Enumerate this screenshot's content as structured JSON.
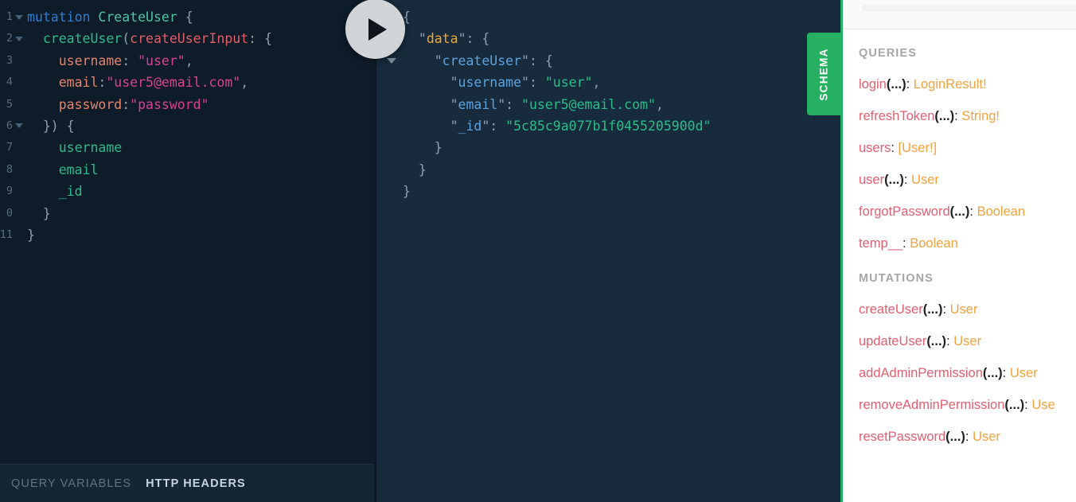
{
  "query_editor": {
    "lines": [
      {
        "num": "1",
        "fold": true,
        "tokens": [
          {
            "c": "t-kw",
            "t": "mutation"
          },
          {
            "c": "t-punct",
            "t": " "
          },
          {
            "c": "t-opname",
            "t": "CreateUser"
          },
          {
            "c": "t-punct",
            "t": " {"
          }
        ]
      },
      {
        "num": "2",
        "fold": true,
        "tokens": [
          {
            "c": "t-punct",
            "t": "  "
          },
          {
            "c": "t-field",
            "t": "createUser"
          },
          {
            "c": "t-punct",
            "t": "("
          },
          {
            "c": "t-argdef",
            "t": "createUserInput"
          },
          {
            "c": "t-punct",
            "t": ": {"
          }
        ]
      },
      {
        "num": "3",
        "fold": false,
        "tokens": [
          {
            "c": "t-punct",
            "t": "    "
          },
          {
            "c": "t-arg",
            "t": "username"
          },
          {
            "c": "t-punct",
            "t": ": "
          },
          {
            "c": "t-str",
            "t": "\"user\""
          },
          {
            "c": "t-punct",
            "t": ","
          }
        ]
      },
      {
        "num": "4",
        "fold": false,
        "tokens": [
          {
            "c": "t-punct",
            "t": "    "
          },
          {
            "c": "t-arg",
            "t": "email"
          },
          {
            "c": "t-punct",
            "t": ":"
          },
          {
            "c": "t-str",
            "t": "\"user5@email.com\""
          },
          {
            "c": "t-punct",
            "t": ","
          }
        ]
      },
      {
        "num": "5",
        "fold": false,
        "tokens": [
          {
            "c": "t-punct",
            "t": "    "
          },
          {
            "c": "t-arg",
            "t": "password"
          },
          {
            "c": "t-punct",
            "t": ":"
          },
          {
            "c": "t-str",
            "t": "\"password\""
          }
        ]
      },
      {
        "num": "6",
        "fold": true,
        "tokens": [
          {
            "c": "t-punct",
            "t": "  }) {"
          }
        ]
      },
      {
        "num": "7",
        "fold": false,
        "tokens": [
          {
            "c": "t-punct",
            "t": "    "
          },
          {
            "c": "t-field",
            "t": "username"
          }
        ]
      },
      {
        "num": "8",
        "fold": false,
        "tokens": [
          {
            "c": "t-punct",
            "t": "    "
          },
          {
            "c": "t-field",
            "t": "email"
          }
        ]
      },
      {
        "num": "9",
        "fold": false,
        "tokens": [
          {
            "c": "t-punct",
            "t": "    "
          },
          {
            "c": "t-field",
            "t": "_id"
          }
        ]
      },
      {
        "num": "0",
        "fold": false,
        "shift": true,
        "tokens": [
          {
            "c": "t-punct",
            "t": "  }"
          }
        ]
      },
      {
        "num": "11",
        "fold": false,
        "shift": true,
        "tokens": [
          {
            "c": "t-punct",
            "t": "}"
          }
        ]
      }
    ]
  },
  "variables_bar": {
    "query_variables_label": "QUERY VARIABLES",
    "http_headers_label": "HTTP HEADERS",
    "active_tab": "HTTP HEADERS"
  },
  "run_button": {
    "name": "execute-query",
    "icon": "play-icon"
  },
  "result_panel": {
    "lines": [
      {
        "fold": true,
        "tokens": [
          {
            "c": "j-punct",
            "t": "{"
          }
        ]
      },
      {
        "fold": true,
        "tokens": [
          {
            "c": "j-punct",
            "t": "  \""
          },
          {
            "c": "j-data",
            "t": "data"
          },
          {
            "c": "j-punct",
            "t": "\": {"
          }
        ]
      },
      {
        "fold": true,
        "tokens": [
          {
            "c": "j-punct",
            "t": "    \""
          },
          {
            "c": "j-key",
            "t": "createUser"
          },
          {
            "c": "j-punct",
            "t": "\": {"
          }
        ]
      },
      {
        "fold": false,
        "tokens": [
          {
            "c": "j-punct",
            "t": "      \""
          },
          {
            "c": "j-key",
            "t": "username"
          },
          {
            "c": "j-punct",
            "t": "\": "
          },
          {
            "c": "j-str",
            "t": "\"user\""
          },
          {
            "c": "j-punct",
            "t": ","
          }
        ]
      },
      {
        "fold": false,
        "tokens": [
          {
            "c": "j-punct",
            "t": "      \""
          },
          {
            "c": "j-key",
            "t": "email"
          },
          {
            "c": "j-punct",
            "t": "\": "
          },
          {
            "c": "j-str",
            "t": "\"user5@email.com\""
          },
          {
            "c": "j-punct",
            "t": ","
          }
        ]
      },
      {
        "fold": false,
        "tokens": [
          {
            "c": "j-punct",
            "t": "      \""
          },
          {
            "c": "j-key",
            "t": "_id"
          },
          {
            "c": "j-punct",
            "t": "\": "
          },
          {
            "c": "j-str",
            "t": "\"5c85c9a077b1f0455205900d\""
          }
        ]
      },
      {
        "fold": false,
        "tokens": [
          {
            "c": "j-punct",
            "t": "    }"
          }
        ]
      },
      {
        "fold": false,
        "tokens": [
          {
            "c": "j-punct",
            "t": "  }"
          }
        ]
      },
      {
        "fold": false,
        "tokens": [
          {
            "c": "j-punct",
            "t": "}"
          }
        ]
      }
    ]
  },
  "schema_tab": {
    "label": "SCHEMA",
    "color": "#25b161"
  },
  "docs": {
    "queries_title": "QUERIES",
    "mutations_title": "MUTATIONS",
    "queries": [
      {
        "name": "login",
        "args": "(...)",
        "colon": ": ",
        "type": "LoginResult!"
      },
      {
        "name": "refreshToken",
        "args": "(...)",
        "colon": ": ",
        "type": "String!"
      },
      {
        "name": "users",
        "args": "",
        "colon": ": ",
        "type": "[User!]"
      },
      {
        "name": "user",
        "args": "(...)",
        "colon": ": ",
        "type": "User"
      },
      {
        "name": "forgotPassword",
        "args": "(...)",
        "colon": ": ",
        "type": "Boolean"
      },
      {
        "name": "temp__",
        "args": "",
        "colon": ": ",
        "type": "Boolean"
      }
    ],
    "mutations": [
      {
        "name": "createUser",
        "args": "(...)",
        "colon": ": ",
        "type": "User"
      },
      {
        "name": "updateUser",
        "args": "(...)",
        "colon": ": ",
        "type": "User"
      },
      {
        "name": "addAdminPermission",
        "args": "(...)",
        "colon": ": ",
        "type": "User"
      },
      {
        "name": "removeAdminPermission",
        "args": "(...)",
        "colon": ": ",
        "type": "Use"
      },
      {
        "name": "resetPassword",
        "args": "(...)",
        "colon": ": ",
        "type": "User"
      }
    ]
  },
  "theme": {
    "editor_bg": "#0e1c29",
    "result_bg": "#172b3c",
    "accent_green": "#25b161",
    "docs_bg": "#ffffff"
  }
}
